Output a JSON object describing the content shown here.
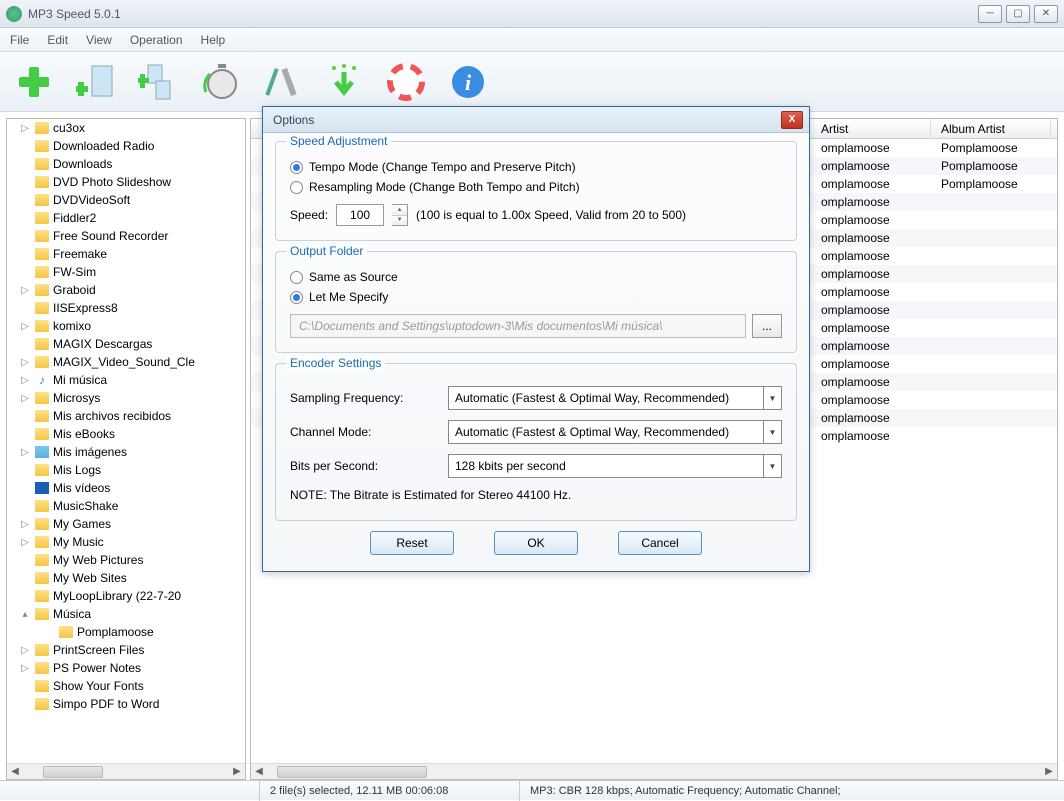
{
  "window": {
    "title": "MP3 Speed 5.0.1"
  },
  "menu": {
    "file": "File",
    "edit": "Edit",
    "view": "View",
    "operation": "Operation",
    "help": "Help"
  },
  "tree": {
    "items": [
      {
        "exp": "▷",
        "icon": "folder",
        "label": "cu3ox"
      },
      {
        "exp": "",
        "icon": "folder",
        "label": "Downloaded Radio"
      },
      {
        "exp": "",
        "icon": "folder",
        "label": "Downloads"
      },
      {
        "exp": "",
        "icon": "folder",
        "label": "DVD Photo Slideshow"
      },
      {
        "exp": "",
        "icon": "folder",
        "label": "DVDVideoSoft"
      },
      {
        "exp": "",
        "icon": "folder",
        "label": "Fiddler2"
      },
      {
        "exp": "",
        "icon": "folder",
        "label": "Free Sound Recorder"
      },
      {
        "exp": "",
        "icon": "folder",
        "label": "Freemake"
      },
      {
        "exp": "",
        "icon": "folder",
        "label": "FW-Sim"
      },
      {
        "exp": "▷",
        "icon": "folder",
        "label": "Graboid"
      },
      {
        "exp": "",
        "icon": "folder",
        "label": "IISExpress8"
      },
      {
        "exp": "▷",
        "icon": "folder",
        "label": "komixo"
      },
      {
        "exp": "",
        "icon": "folder",
        "label": "MAGIX Descargas"
      },
      {
        "exp": "▷",
        "icon": "folder",
        "label": "MAGIX_Video_Sound_Cle"
      },
      {
        "exp": "▷",
        "icon": "music",
        "label": "Mi música"
      },
      {
        "exp": "▷",
        "icon": "folder",
        "label": "Microsys"
      },
      {
        "exp": "",
        "icon": "folder",
        "label": "Mis archivos recibidos"
      },
      {
        "exp": "",
        "icon": "folder",
        "label": "Mis eBooks"
      },
      {
        "exp": "▷",
        "icon": "pic",
        "label": "Mis imágenes"
      },
      {
        "exp": "",
        "icon": "folder",
        "label": "Mis Logs"
      },
      {
        "exp": "",
        "icon": "video",
        "label": "Mis vídeos"
      },
      {
        "exp": "",
        "icon": "folder",
        "label": "MusicShake"
      },
      {
        "exp": "▷",
        "icon": "folder",
        "label": "My Games"
      },
      {
        "exp": "▷",
        "icon": "folder",
        "label": "My Music"
      },
      {
        "exp": "",
        "icon": "folder",
        "label": "My Web Pictures"
      },
      {
        "exp": "",
        "icon": "folder",
        "label": "My Web Sites"
      },
      {
        "exp": "",
        "icon": "folder",
        "label": "MyLoopLibrary (22-7-20"
      },
      {
        "exp": "▴",
        "icon": "folder",
        "label": "Música"
      },
      {
        "exp": "",
        "icon": "folder",
        "label": "Pomplamoose",
        "sub": true
      },
      {
        "exp": "▷",
        "icon": "folder",
        "label": "PrintScreen Files"
      },
      {
        "exp": "▷",
        "icon": "folder",
        "label": "PS Power Notes"
      },
      {
        "exp": "",
        "icon": "folder",
        "label": "Show Your Fonts"
      },
      {
        "exp": "",
        "icon": "folder",
        "label": "Simpo PDF to Word"
      }
    ]
  },
  "list": {
    "columns": {
      "artist": "Artist",
      "album_artist": "Album Artist"
    },
    "rows": [
      {
        "artist": "omplamoose",
        "album_artist": "Pomplamoose"
      },
      {
        "artist": "omplamoose",
        "album_artist": "Pomplamoose"
      },
      {
        "artist": "omplamoose",
        "album_artist": "Pomplamoose"
      },
      {
        "artist": "omplamoose",
        "album_artist": ""
      },
      {
        "artist": "omplamoose",
        "album_artist": ""
      },
      {
        "artist": "omplamoose",
        "album_artist": ""
      },
      {
        "artist": "omplamoose",
        "album_artist": ""
      },
      {
        "artist": "omplamoose",
        "album_artist": ""
      },
      {
        "artist": "omplamoose",
        "album_artist": ""
      },
      {
        "artist": "omplamoose",
        "album_artist": ""
      },
      {
        "artist": "omplamoose",
        "album_artist": ""
      },
      {
        "artist": "omplamoose",
        "album_artist": ""
      },
      {
        "artist": "omplamoose",
        "album_artist": ""
      },
      {
        "artist": "omplamoose",
        "album_artist": ""
      },
      {
        "artist": "omplamoose",
        "album_artist": ""
      },
      {
        "artist": "omplamoose",
        "album_artist": ""
      },
      {
        "artist": "omplamoose",
        "album_artist": ""
      }
    ]
  },
  "dialog": {
    "title": "Options",
    "speed_adj": {
      "legend": "Speed Adjustment",
      "tempo": "Tempo Mode (Change Tempo and Preserve Pitch)",
      "resample": "Resampling Mode (Change Both Tempo and Pitch)",
      "speed_label": "Speed:",
      "speed_value": "100",
      "speed_hint": "(100 is equal to 1.00x Speed, Valid from 20 to 500)"
    },
    "output": {
      "legend": "Output Folder",
      "same": "Same as Source",
      "specify": "Let Me Specify",
      "path": "C:\\Documents and Settings\\uptodown-3\\Mis documentos\\Mi música\\",
      "browse": "..."
    },
    "encoder": {
      "legend": "Encoder Settings",
      "sampling_label": "Sampling Frequency:",
      "sampling_value": "Automatic (Fastest & Optimal Way, Recommended)",
      "channel_label": "Channel Mode:",
      "channel_value": "Automatic (Fastest & Optimal Way, Recommended)",
      "bits_label": "Bits per Second:",
      "bits_value": "128 kbits per second",
      "note": "NOTE: The Bitrate is Estimated  for Stereo 44100 Hz."
    },
    "buttons": {
      "reset": "Reset",
      "ok": "OK",
      "cancel": "Cancel"
    }
  },
  "status": {
    "selection": "2 file(s) selected, 12.11 MB    00:06:08",
    "format": "MP3:  CBR 128 kbps; Automatic Frequency; Automatic Channel;"
  }
}
